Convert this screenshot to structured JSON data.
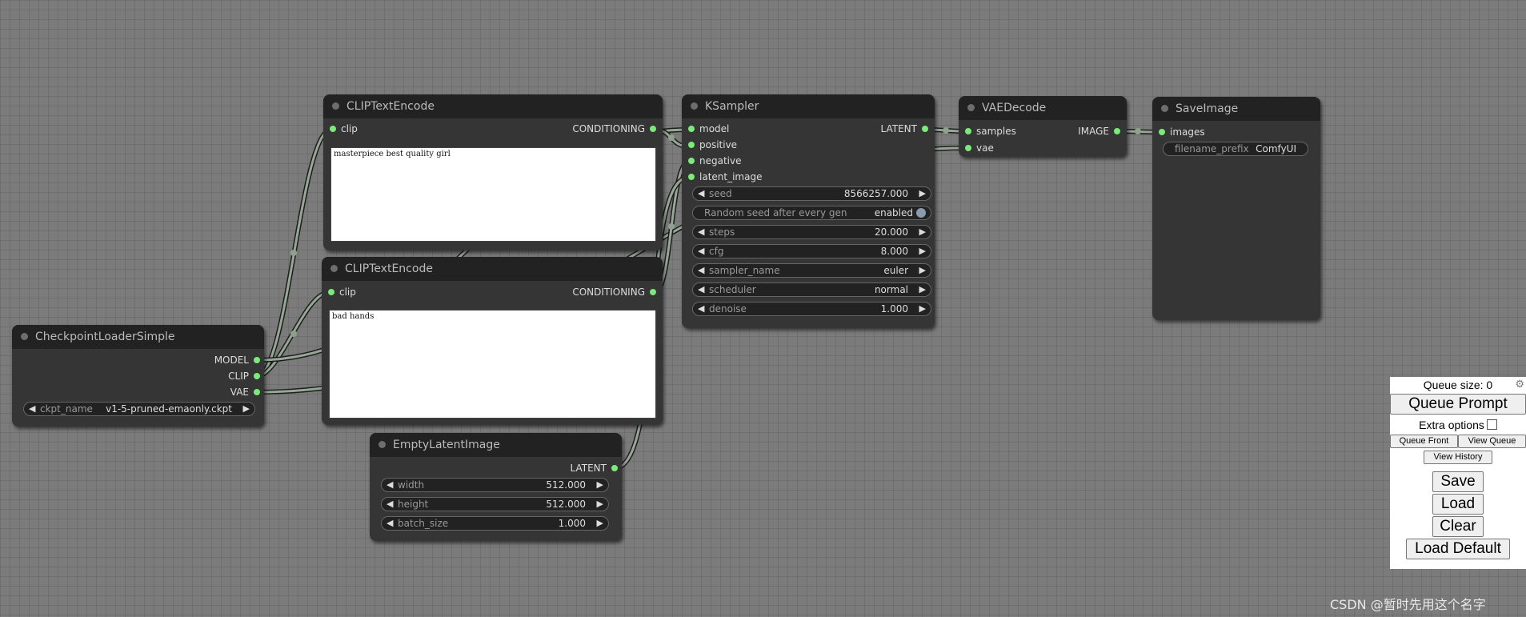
{
  "nodes": {
    "clip_positive": {
      "title": "CLIPTextEncode",
      "input": "clip",
      "output": "CONDITIONING",
      "text": "masterpiece best quality girl"
    },
    "clip_negative": {
      "title": "CLIPTextEncode",
      "input": "clip",
      "output": "CONDITIONING",
      "text": "bad hands"
    },
    "ksampler": {
      "title": "KSampler",
      "inputs": [
        "model",
        "positive",
        "negative",
        "latent_image"
      ],
      "output": "LATENT",
      "widgets": {
        "seed": {
          "label": "seed",
          "value": "8566257.000"
        },
        "random_seed": {
          "label": "Random seed after every gen",
          "value": "enabled"
        },
        "steps": {
          "label": "steps",
          "value": "20.000"
        },
        "cfg": {
          "label": "cfg",
          "value": "8.000"
        },
        "sampler_name": {
          "label": "sampler_name",
          "value": "euler"
        },
        "scheduler": {
          "label": "scheduler",
          "value": "normal"
        },
        "denoise": {
          "label": "denoise",
          "value": "1.000"
        }
      }
    },
    "vaedecode": {
      "title": "VAEDecode",
      "inputs": [
        "samples",
        "vae"
      ],
      "output": "IMAGE"
    },
    "saveimage": {
      "title": "SaveImage",
      "input": "images",
      "widget": {
        "label": "filename_prefix",
        "value": "ComfyUI"
      }
    },
    "checkpoint": {
      "title": "CheckpointLoaderSimple",
      "outputs": [
        "MODEL",
        "CLIP",
        "VAE"
      ],
      "widget": {
        "label": "ckpt_name",
        "value": "v1-5-pruned-emaonly.ckpt"
      }
    },
    "emptylatent": {
      "title": "EmptyLatentImage",
      "output": "LATENT",
      "widgets": {
        "width": {
          "label": "width",
          "value": "512.000"
        },
        "height": {
          "label": "height",
          "value": "512.000"
        },
        "batch_size": {
          "label": "batch_size",
          "value": "1.000"
        }
      }
    }
  },
  "queue_panel": {
    "queue_size": "Queue size: 0",
    "queue_prompt": "Queue Prompt",
    "extra_options": "Extra options",
    "queue_front": "Queue Front",
    "view_queue": "View Queue",
    "view_history": "View History",
    "save": "Save",
    "load": "Load",
    "clear": "Clear",
    "load_default": "Load Default"
  },
  "watermark": "CSDN @暂时先用这个名字",
  "colors": {
    "canvas": "#7b7b7b",
    "node_body": "#353535",
    "node_title": "#222222",
    "pin": "#7bea7b",
    "link": "#9aa59a"
  },
  "icons": {
    "arrow_left": "◀",
    "arrow_right": "▶",
    "gear": "⚙"
  }
}
